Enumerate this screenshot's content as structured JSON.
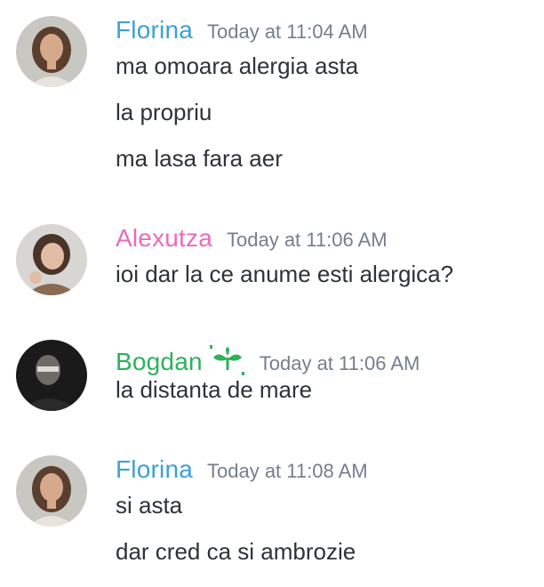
{
  "colors": {
    "florina": "#3e9fd9",
    "alexutza": "#ea6bbd",
    "bogdan": "#2bb25b",
    "timestamp": "#747f8d",
    "text": "#2e3338"
  },
  "messages": [
    {
      "author": "Florina",
      "timestamp": "Today at 11:04 AM",
      "avatar_icon": "woman-portrait-avatar",
      "lines": [
        "ma omoara alergia asta",
        "la propriu",
        "ma lasa fara aer"
      ]
    },
    {
      "author": "Alexutza",
      "timestamp": "Today at 11:06 AM",
      "avatar_icon": "woman-portrait-avatar",
      "lines": [
        "ioi dar la ce anume esti alergica?"
      ]
    },
    {
      "author": "Bogdan",
      "timestamp": "Today at 11:06 AM",
      "avatar_icon": "man-dark-portrait-avatar",
      "badge_icon": "green-sprout-icon",
      "lines": [
        "la distanta de mare"
      ]
    },
    {
      "author": "Florina",
      "timestamp": "Today at 11:08 AM",
      "avatar_icon": "woman-portrait-avatar",
      "lines": [
        "si asta",
        "dar cred ca si ambrozie"
      ]
    }
  ]
}
